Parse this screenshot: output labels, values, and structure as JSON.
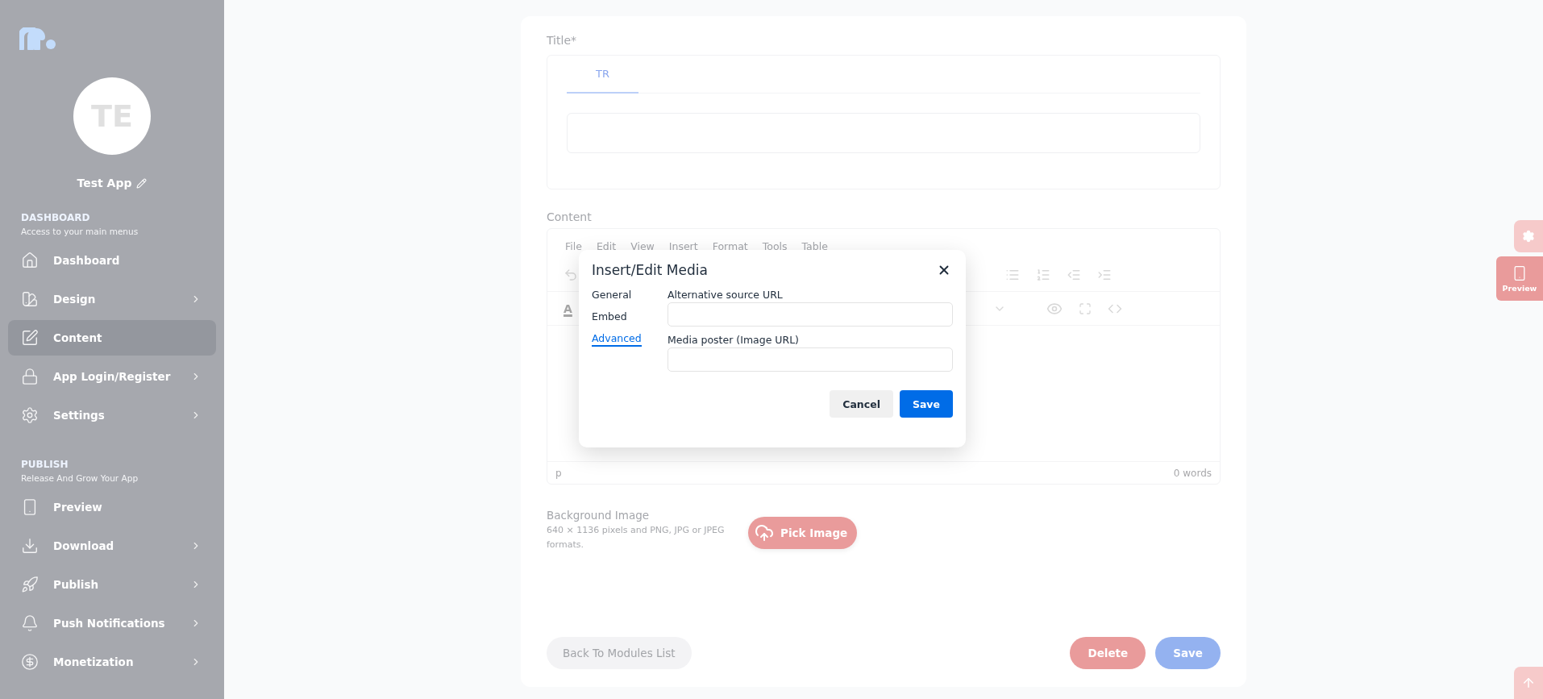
{
  "sidebar": {
    "avatar_initials": "TE",
    "app_name": "Test App",
    "sections": [
      {
        "title": "DASHBOARD",
        "subtitle": "Access to your main menus",
        "items": [
          {
            "label": "Dashboard",
            "has_submenu": false,
            "selected": false
          },
          {
            "label": "Design",
            "has_submenu": true,
            "selected": false
          },
          {
            "label": "Content",
            "has_submenu": false,
            "selected": true
          },
          {
            "label": "App Login/Register",
            "has_submenu": true,
            "selected": false
          },
          {
            "label": "Settings",
            "has_submenu": true,
            "selected": false
          }
        ]
      },
      {
        "title": "PUBLISH",
        "subtitle": "Release And Grow Your App",
        "items": [
          {
            "label": "Preview",
            "has_submenu": false,
            "selected": false
          },
          {
            "label": "Download",
            "has_submenu": true,
            "selected": false
          },
          {
            "label": "Publish",
            "has_submenu": true,
            "selected": false
          },
          {
            "label": "Push Notifications",
            "has_submenu": true,
            "selected": false
          },
          {
            "label": "Monetization",
            "has_submenu": true,
            "selected": false
          }
        ]
      }
    ]
  },
  "form": {
    "title_label": "Title*",
    "language_tabs": [
      {
        "label": "TR",
        "selected": true
      }
    ],
    "content_label": "Content",
    "editor": {
      "menu": [
        "File",
        "Edit",
        "View",
        "Insert",
        "Format",
        "Tools",
        "Table"
      ],
      "format_letter": "A",
      "status_path": "p",
      "word_count": "0 words"
    },
    "background": {
      "label": "Background Image",
      "hint": "640 × 1136 pixels and PNG, JPG or JPEG formats.",
      "pick_button": "Pick Image"
    },
    "back_button": "Back To Modules List",
    "delete_button": "Delete",
    "save_button": "Save"
  },
  "side_buttons": {
    "preview_label": "Preview"
  },
  "dialog": {
    "title": "Insert/Edit Media",
    "tabs": [
      {
        "label": "General",
        "selected": false
      },
      {
        "label": "Embed",
        "selected": false
      },
      {
        "label": "Advanced",
        "selected": true
      }
    ],
    "fields": [
      {
        "label": "Alternative source URL"
      },
      {
        "label": "Media poster (Image URL)"
      }
    ],
    "cancel_button": "Cancel",
    "save_button": "Save"
  }
}
